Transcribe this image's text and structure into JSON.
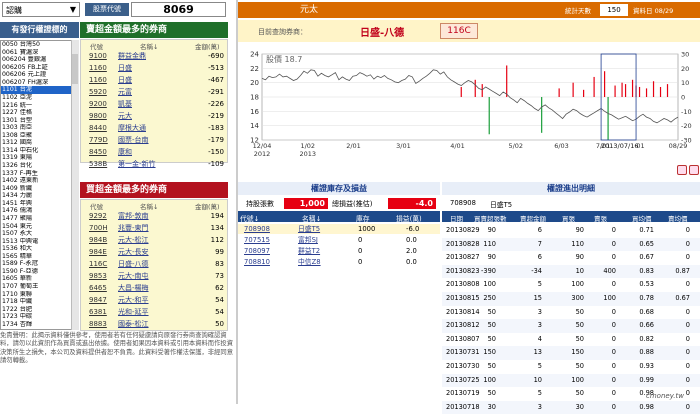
{
  "top_left": {
    "type_select": "認購",
    "type_arrow": "▼",
    "code_label": "股票代號",
    "code_value": "8069"
  },
  "stock_list": {
    "header": "有發行權證標的",
    "items": [
      "0050 台灣50",
      "0061 寶滬深",
      "006204 豐銀滬",
      "006205 FB上証",
      "006206 元上證",
      "006207 FH滬深",
      "1101 台泥",
      "1102 亞泥",
      "1216 統一",
      "1227 佳格",
      "1301 台塑",
      "1303 南亞",
      "1308 亞聚",
      "1312 國喬",
      "1314 中石化",
      "1319 東陽",
      "1326 台化",
      "1337 F-再生",
      "1402 遠東新",
      "1409 新纖",
      "1434 力麗",
      "1451 年興",
      "1476 儒鴻",
      "1477 聚陽",
      "1504 東元",
      "1507 永大",
      "1513 中興電",
      "1536 和大",
      "1565 精華",
      "1589 F-永冠",
      "1590 F-亞德",
      "1605 華新",
      "1707 葡萄王",
      "1710 東聯",
      "1718 中纖",
      "1722 台肥",
      "1723 中碳",
      "1734 杏輝"
    ],
    "selected_index": 6
  },
  "disclaimer": "免責聲明：此揭示資料僅供參考，使用者若有任何疑慮請向原發行券商查詢確認資料，請勿以此資訊作為買賣或進出依據。使用者如果因本資料或引用本資料而作投資決策所生之損失，本公司及資料提供者恕不負責。此資料受著作權法保護，非經同意請勿轉載。",
  "sell_table": {
    "title": "賣超金額最多的券商",
    "col_code": "代號",
    "col_name": "名稱↓",
    "col_value": "金額(萬)",
    "rows": [
      {
        "code": "9100",
        "name": "群益金鼎",
        "value": "-690"
      },
      {
        "code": "1160",
        "name": "日盛",
        "value": "-513"
      },
      {
        "code": "1160",
        "name": "日盛",
        "value": "-467"
      },
      {
        "code": "5920",
        "name": "元富",
        "value": "-291"
      },
      {
        "code": "9200",
        "name": "凱基",
        "value": "-226"
      },
      {
        "code": "9800",
        "name": "元大",
        "value": "-219"
      },
      {
        "code": "8440",
        "name": "摩根大通",
        "value": "-183"
      },
      {
        "code": "779D",
        "name": "國票-台南",
        "value": "-179"
      },
      {
        "code": "8450",
        "name": "康和",
        "value": "-150"
      },
      {
        "code": "538B",
        "name": "第一金-新竹",
        "value": "-109"
      }
    ]
  },
  "buy_table": {
    "title": "買超金額最多的券商",
    "col_code": "代號",
    "col_name": "名稱↓",
    "col_value": "金額(萬)",
    "rows": [
      {
        "code": "9292",
        "name": "富邦-敦南",
        "value": "194"
      },
      {
        "code": "700H",
        "name": "兆豐-東門",
        "value": "134"
      },
      {
        "code": "984B",
        "name": "元大-松江",
        "value": "112"
      },
      {
        "code": "984E",
        "name": "元大-長安",
        "value": "99"
      },
      {
        "code": "116C",
        "name": "日盛-八德",
        "value": "83"
      },
      {
        "code": "9853",
        "name": "元大-南屯",
        "value": "73"
      },
      {
        "code": "6465",
        "name": "大昌-楊梅",
        "value": "62"
      },
      {
        "code": "9847",
        "name": "元大-和平",
        "value": "54"
      },
      {
        "code": "6381",
        "name": "光和-延平",
        "value": "54"
      },
      {
        "code": "8883",
        "name": "國泰-松江",
        "value": "50"
      }
    ]
  },
  "right_header": {
    "title": "元太",
    "days_label": "統計天數",
    "days_value": "150",
    "date_label": "資料日 08/29",
    "sub_label": "目前查詢券商：",
    "broker_name": "日盛-八德",
    "broker_code": "116C"
  },
  "chart_data": {
    "type": "line",
    "title": "股價 18.7",
    "x_tick_labels": [
      "12/04\n2012",
      "1/02\n2013",
      "2/01",
      "3/01",
      "4/01",
      "5/02",
      "6/03",
      "7/01",
      "2013/07/16",
      "01",
      "08/29"
    ],
    "x_tick_positions": [
      0,
      0.11,
      0.22,
      0.34,
      0.47,
      0.61,
      0.72,
      0.82,
      0.86,
      0.91,
      1.0
    ],
    "ylim_left": [
      12,
      24
    ],
    "y_ticks_left": [
      12,
      14,
      16,
      18,
      20,
      22,
      24
    ],
    "ylim_right": [
      -30,
      30
    ],
    "y_ticks_right": [
      -30,
      -20,
      -10,
      0,
      10,
      20,
      30
    ],
    "price_series": [
      20.6,
      20.4,
      20.9,
      20.7,
      20.8,
      21.2,
      20.8,
      20.9,
      20.6,
      20.3,
      20.5,
      21.0,
      21.6,
      21.3,
      21.8,
      21.7,
      20.9,
      21.3,
      21.0,
      20.8,
      21.1,
      21.4,
      20.4,
      20.8,
      20.5,
      20.3,
      20.9,
      21.0,
      21.4,
      21.2,
      20.9,
      21.1,
      20.5,
      20.9,
      20.7,
      21.0,
      20.6,
      20.4,
      20.1,
      20.0,
      20.3,
      20.5,
      21.0,
      20.8,
      19.9,
      20.2,
      20.6,
      20.9,
      21.3,
      21.8,
      21.7,
      21.2,
      21.5,
      20.8,
      20.4,
      20.1,
      19.8,
      19.6,
      20.0,
      20.3,
      20.1,
      19.7,
      19.2,
      19.0,
      19.4,
      19.1,
      18.8,
      18.5,
      18.2,
      18.7,
      18.4,
      17.9,
      17.6,
      17.2,
      17.8,
      17.5,
      17.1,
      16.8,
      16.4,
      16.1,
      16.6,
      16.9,
      16.5,
      16.2,
      15.8,
      15.4,
      15.0,
      15.6,
      15.9,
      16.3,
      16.1,
      15.7,
      15.4,
      15.2,
      15.5,
      15.8,
      16.1,
      16.4,
      16.0,
      15.7,
      15.5,
      15.2,
      14.9,
      15.1,
      15.3,
      15.0,
      14.7,
      14.9,
      15.3,
      15.6,
      15.2,
      15.0,
      14.6,
      14.4,
      14.7,
      15.0,
      14.8,
      14.5,
      14.9,
      15.2
    ],
    "bars": [
      {
        "i": 57,
        "v": 7
      },
      {
        "i": 61,
        "v": 12
      },
      {
        "i": 63,
        "v": 9
      },
      {
        "i": 65,
        "v": -26
      },
      {
        "i": 70,
        "v": 22
      },
      {
        "i": 80,
        "v": -25
      },
      {
        "i": 85,
        "v": 6
      },
      {
        "i": 89,
        "v": 10
      },
      {
        "i": 92,
        "v": 5
      },
      {
        "i": 95,
        "v": 14
      },
      {
        "i": 98,
        "v": 18
      },
      {
        "i": 99,
        "v": -30
      },
      {
        "i": 101,
        "v": 8
      },
      {
        "i": 103,
        "v": 10
      },
      {
        "i": 104,
        "v": 9
      },
      {
        "i": 106,
        "v": 12
      },
      {
        "i": 107,
        "v": 8
      },
      {
        "i": 108,
        "v": 7
      },
      {
        "i": 110,
        "v": 6
      },
      {
        "i": 112,
        "v": 11
      },
      {
        "i": 114,
        "v": 7
      },
      {
        "i": 116,
        "v": 9
      }
    ],
    "colors": {
      "price": "#555555",
      "buy": "#e60012",
      "sell": "#1a9e3a",
      "highlight_box": "#1e3d8f"
    }
  },
  "inventory": {
    "header": "權證庫存及損益",
    "holdings_label": "持股張數",
    "holdings_value": "1,000",
    "pnl_label": "總損益(推估)",
    "pnl_value": "-4.0",
    "cols": [
      "代號↓",
      "名稱↓",
      "庫存",
      "損益(萬)"
    ],
    "rows": [
      {
        "code": "708908",
        "name": "日盛T5",
        "stock": "1000",
        "pnl": "-6.0"
      },
      {
        "code": "707515",
        "name": "富邦SJ",
        "stock": "0",
        "pnl": "0.0"
      },
      {
        "code": "708097",
        "name": "群益T2",
        "stock": "0",
        "pnl": "2.0"
      },
      {
        "code": "708810",
        "name": "中信Z8",
        "stock": "0",
        "pnl": "0.0"
      }
    ]
  },
  "detail": {
    "header": "權證進出明細",
    "sub_code": "708908",
    "sub_name": "日盛T5",
    "cols": [
      "日期",
      "買賣超張數",
      "賣超金額",
      "買張",
      "賣張",
      "買均價",
      "賣均價"
    ],
    "rows": [
      [
        "20130829",
        "90",
        "6",
        "90",
        "0",
        "0.71",
        "0"
      ],
      [
        "20130828",
        "110",
        "7",
        "110",
        "0",
        "0.65",
        "0"
      ],
      [
        "20130827",
        "90",
        "6",
        "90",
        "0",
        "0.67",
        "0"
      ],
      [
        "20130823",
        "-390",
        "-34",
        "10",
        "400",
        "0.83",
        "0.87"
      ],
      [
        "20130808",
        "100",
        "5",
        "100",
        "0",
        "0.53",
        "0"
      ],
      [
        "20130815",
        "250",
        "15",
        "300",
        "100",
        "0.78",
        "0.67"
      ],
      [
        "20130814",
        "50",
        "3",
        "50",
        "0",
        "0.68",
        "0"
      ],
      [
        "20130812",
        "50",
        "3",
        "50",
        "0",
        "0.66",
        "0"
      ],
      [
        "20130807",
        "50",
        "4",
        "50",
        "0",
        "0.82",
        "0"
      ],
      [
        "20130731",
        "150",
        "13",
        "150",
        "0",
        "0.88",
        "0"
      ],
      [
        "20130730",
        "50",
        "5",
        "50",
        "0",
        "0.93",
        "0"
      ],
      [
        "20130725",
        "100",
        "10",
        "100",
        "0",
        "0.99",
        "0"
      ],
      [
        "20130719",
        "50",
        "5",
        "50",
        "0",
        "0.98",
        "0"
      ],
      [
        "20130718",
        "30",
        "3",
        "30",
        "0",
        "0.98",
        "0"
      ]
    ]
  },
  "watermark": "cmoney.tw"
}
